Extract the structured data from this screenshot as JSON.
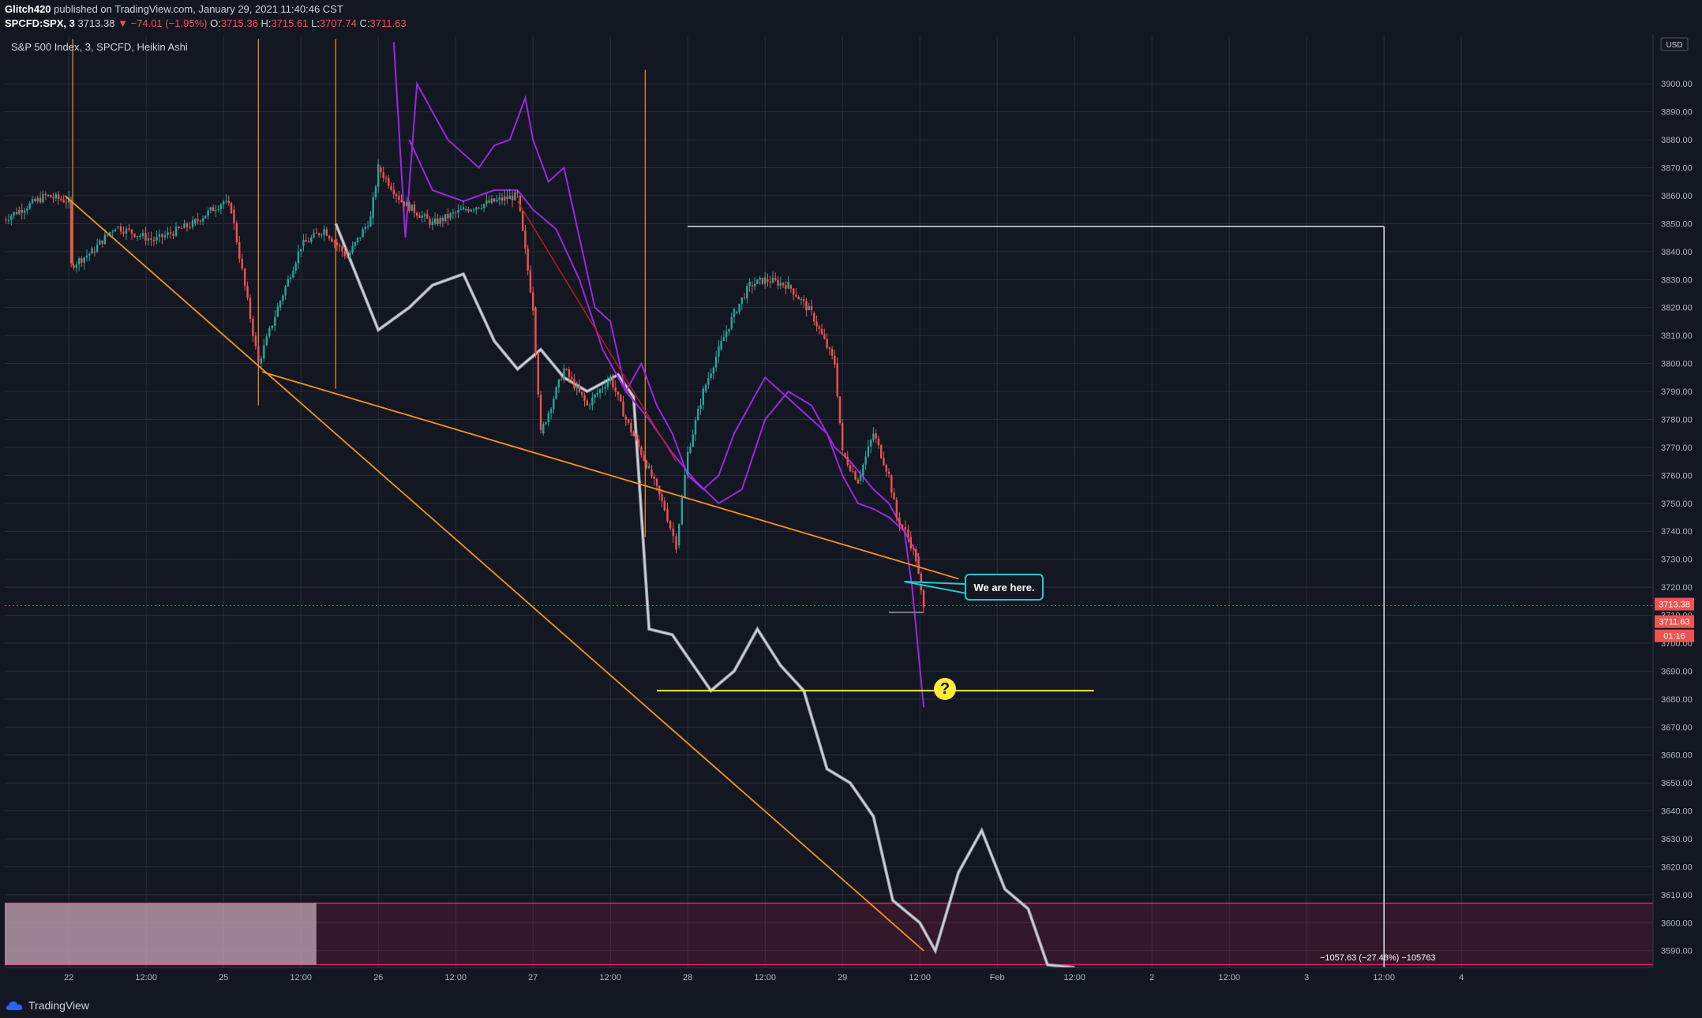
{
  "header": {
    "author": "Glitch420",
    "published": " published on TradingView.com, January 29, 2021 11:40:46 CST",
    "symbol": "SPCFD:SPX, 3",
    "price": "3713.38",
    "change": "−74.01 (−1.95%)",
    "o_label": "O:",
    "o_value": "3715.36",
    "h_label": "H:",
    "h_value": "3715.61",
    "l_label": "L:",
    "l_value": "3707.74",
    "c_label": "C:",
    "c_value": "3711.63"
  },
  "callout": {
    "text": "We are here."
  },
  "question": {
    "text": "?"
  },
  "measure": {
    "text": "−1057.63 (−27.48%) −105763"
  },
  "footer": {
    "brand": "TradingView"
  },
  "colors": {
    "background": "#131722",
    "grid": "#2a2e39",
    "up": "#26a69a",
    "down": "#ef5350",
    "orange": "#f7931a",
    "purple": "#9c27e0",
    "white_path": "#d1d4dc",
    "yellow": "#ffeb3b",
    "cyan": "#26c6da",
    "zone": "#e91e63",
    "zone_left": "#b8a0b0"
  },
  "chart_data": {
    "type": "candlestick",
    "title": "S&P 500 Index, 3, SPCFD, Heikin Ashi",
    "currency": "USD",
    "x_ticks": [
      "22",
      "12:00",
      "25",
      "12:00",
      "26",
      "12:00",
      "27",
      "12:00",
      "28",
      "12:00",
      "29",
      "12:00",
      "Feb",
      "12:00",
      "2",
      "12:00",
      "3",
      "12:00",
      "4"
    ],
    "y_ticks": [
      3590,
      3600,
      3610,
      3620,
      3630,
      3640,
      3650,
      3660,
      3670,
      3680,
      3690,
      3700,
      3710,
      3720,
      3730,
      3740,
      3750,
      3760,
      3770,
      3780,
      3790,
      3800,
      3810,
      3820,
      3830,
      3840,
      3850,
      3860,
      3870,
      3880,
      3890,
      3900
    ],
    "ylim": [
      3584,
      3917
    ],
    "x_tick_slots": [
      0.9,
      1.9,
      2.9,
      3.9,
      4.9,
      5.9,
      6.9,
      7.9,
      8.9,
      9.9,
      10.9,
      11.9,
      12.9,
      13.9,
      14.9,
      15.9,
      16.9,
      17.9,
      18.9
    ],
    "price_path": [
      [
        0.02,
        3851
      ],
      [
        0.6,
        3860
      ],
      [
        0.9,
        3858
      ],
      [
        0.93,
        3835
      ],
      [
        1.2,
        3840
      ],
      [
        1.5,
        3849
      ],
      [
        2.0,
        3844
      ],
      [
        2.5,
        3850
      ],
      [
        2.9,
        3858
      ],
      [
        3.0,
        3855
      ],
      [
        3.35,
        3800
      ],
      [
        3.6,
        3820
      ],
      [
        3.9,
        3842
      ],
      [
        4.2,
        3848
      ],
      [
        4.5,
        3838
      ],
      [
        4.8,
        3852
      ],
      [
        4.9,
        3870
      ],
      [
        5.2,
        3858
      ],
      [
        5.6,
        3850
      ],
      [
        6.0,
        3855
      ],
      [
        6.4,
        3858
      ],
      [
        6.7,
        3860
      ],
      [
        6.9,
        3820
      ],
      [
        7.0,
        3775
      ],
      [
        7.3,
        3798
      ],
      [
        7.6,
        3785
      ],
      [
        7.9,
        3795
      ],
      [
        8.1,
        3780
      ],
      [
        8.4,
        3762
      ],
      [
        8.6,
        3748
      ],
      [
        8.75,
        3735
      ],
      [
        8.9,
        3768
      ],
      [
        9.1,
        3790
      ],
      [
        9.3,
        3805
      ],
      [
        9.5,
        3818
      ],
      [
        9.7,
        3828
      ],
      [
        9.9,
        3830
      ],
      [
        10.2,
        3828
      ],
      [
        10.5,
        3818
      ],
      [
        10.8,
        3800
      ],
      [
        10.9,
        3768
      ],
      [
        11.1,
        3758
      ],
      [
        11.3,
        3775
      ],
      [
        11.5,
        3760
      ],
      [
        11.6,
        3745
      ],
      [
        11.75,
        3738
      ],
      [
        11.85,
        3730
      ],
      [
        11.95,
        3712
      ]
    ],
    "last_price": 3713.38,
    "close_price": 3711.63,
    "countdown": "01:16",
    "purple_lines": [
      [
        [
          5.1,
          3915
        ],
        [
          5.25,
          3845
        ],
        [
          5.4,
          3900
        ],
        [
          5.6,
          3890
        ],
        [
          5.8,
          3880
        ],
        [
          6.0,
          3875
        ],
        [
          6.2,
          3870
        ],
        [
          6.4,
          3878
        ],
        [
          6.6,
          3880
        ],
        [
          6.8,
          3895
        ],
        [
          6.9,
          3880
        ],
        [
          7.1,
          3865
        ],
        [
          7.3,
          3870
        ],
        [
          7.5,
          3845
        ],
        [
          7.7,
          3820
        ],
        [
          7.9,
          3815
        ],
        [
          8.1,
          3790
        ],
        [
          8.3,
          3800
        ],
        [
          8.5,
          3785
        ],
        [
          8.7,
          3775
        ],
        [
          8.9,
          3760
        ],
        [
          9.1,
          3755
        ],
        [
          9.3,
          3760
        ],
        [
          9.5,
          3775
        ],
        [
          9.7,
          3785
        ],
        [
          9.9,
          3795
        ],
        [
          10.1,
          3790
        ],
        [
          10.3,
          3785
        ],
        [
          10.5,
          3780
        ],
        [
          10.7,
          3775
        ],
        [
          10.9,
          3760
        ],
        [
          11.1,
          3750
        ],
        [
          11.3,
          3748
        ],
        [
          11.5,
          3745
        ],
        [
          11.7,
          3740
        ],
        [
          11.8,
          3720
        ],
        [
          11.95,
          3677
        ]
      ],
      [
        [
          5.3,
          3880
        ],
        [
          5.6,
          3862
        ],
        [
          6.0,
          3858
        ],
        [
          6.4,
          3862
        ],
        [
          6.7,
          3862
        ],
        [
          6.9,
          3855
        ],
        [
          7.2,
          3848
        ],
        [
          7.5,
          3830
        ],
        [
          7.8,
          3805
        ],
        [
          8.1,
          3790
        ],
        [
          8.4,
          3780
        ],
        [
          8.7,
          3768
        ],
        [
          9.0,
          3758
        ],
        [
          9.3,
          3750
        ],
        [
          9.6,
          3755
        ],
        [
          9.9,
          3780
        ],
        [
          10.2,
          3790
        ],
        [
          10.5,
          3785
        ],
        [
          10.8,
          3770
        ],
        [
          11.0,
          3765
        ],
        [
          11.3,
          3755
        ],
        [
          11.5,
          3750
        ],
        [
          11.7,
          3740
        ],
        [
          11.9,
          3730
        ]
      ]
    ],
    "white_path": [
      [
        4.35,
        3850
      ],
      [
        4.9,
        3812
      ],
      [
        5.3,
        3820
      ],
      [
        5.6,
        3828
      ],
      [
        6.0,
        3832
      ],
      [
        6.4,
        3808
      ],
      [
        6.7,
        3798
      ],
      [
        7.0,
        3805
      ],
      [
        7.3,
        3795
      ],
      [
        7.6,
        3790
      ],
      [
        8.0,
        3796
      ],
      [
        8.2,
        3788
      ],
      [
        8.4,
        3705
      ],
      [
        8.7,
        3703
      ],
      [
        8.9,
        3695
      ],
      [
        9.2,
        3683
      ],
      [
        9.5,
        3690
      ],
      [
        9.8,
        3705
      ],
      [
        10.1,
        3692
      ],
      [
        10.4,
        3683
      ],
      [
        10.7,
        3655
      ],
      [
        11.0,
        3650
      ],
      [
        11.3,
        3638
      ],
      [
        11.55,
        3608
      ],
      [
        11.9,
        3600
      ],
      [
        12.1,
        3590
      ],
      [
        12.4,
        3618
      ],
      [
        12.7,
        3633
      ],
      [
        13.0,
        3612
      ],
      [
        13.3,
        3605
      ],
      [
        13.55,
        3585
      ],
      [
        13.9,
        3584
      ]
    ],
    "pink_zone": {
      "y_range": [
        3585,
        3607
      ],
      "x_range": [
        0.0,
        21.4
      ],
      "left_block_end": 4.1
    },
    "orange_lines": [
      [
        [
          0.85,
          3860
        ],
        [
          11.95,
          3590
        ]
      ],
      [
        [
          3.4,
          3797
        ],
        [
          12.4,
          3723
        ]
      ]
    ],
    "orange_verticals": [
      [
        0.95,
        3916,
        3835
      ],
      [
        3.35,
        3916,
        3785
      ],
      [
        4.35,
        3916,
        3791
      ],
      [
        8.35,
        3905,
        3738
      ]
    ],
    "red_line": [
      [
        6.7,
        3858
      ],
      [
        8.75,
        3765
      ]
    ],
    "yellow_line": {
      "y": 3683,
      "x": [
        8.5,
        14.15
      ]
    },
    "white_box": {
      "y": 3849,
      "x": [
        8.9,
        17.9
      ]
    },
    "range_box": {
      "y": 3711,
      "x": [
        11.5,
        11.95
      ]
    }
  }
}
